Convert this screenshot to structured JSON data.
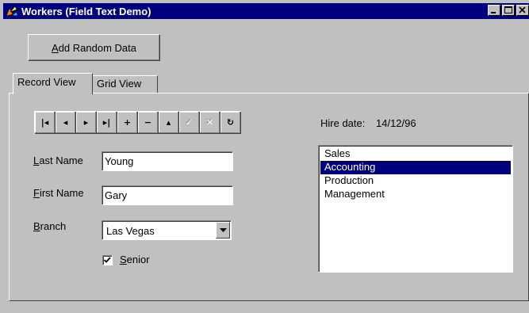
{
  "window": {
    "title": "Workers (Field Text Demo)",
    "title_bg": "#00007f"
  },
  "toolbar": {
    "add_button_label": "Add Random Data"
  },
  "tabs": [
    {
      "label": "Record View",
      "active": true
    },
    {
      "label": "Grid View",
      "active": false
    }
  ],
  "navigator": {
    "buttons": [
      {
        "name": "first-record-button",
        "glyph": "|◂",
        "enabled": true
      },
      {
        "name": "prior-record-button",
        "glyph": "◂",
        "enabled": true
      },
      {
        "name": "next-record-button",
        "glyph": "▸",
        "enabled": true
      },
      {
        "name": "last-record-button",
        "glyph": "▸|",
        "enabled": true
      },
      {
        "name": "insert-record-button",
        "glyph": "+",
        "enabled": true
      },
      {
        "name": "delete-record-button",
        "glyph": "−",
        "enabled": true
      },
      {
        "name": "edit-record-button",
        "glyph": "▴",
        "enabled": true
      },
      {
        "name": "post-record-button",
        "glyph": "✓",
        "enabled": false
      },
      {
        "name": "cancel-record-button",
        "glyph": "✕",
        "enabled": false
      },
      {
        "name": "refresh-record-button",
        "glyph": "↻",
        "enabled": true
      }
    ]
  },
  "hire": {
    "label": "Hire date:",
    "value": "14/12/96"
  },
  "fields": {
    "last_name": {
      "label_first": "L",
      "label_rest": "ast Name",
      "value": "Young"
    },
    "first_name": {
      "label_first": "F",
      "label_rest": "irst Name",
      "value": "Gary"
    },
    "branch": {
      "label_first": "B",
      "label_rest": "ranch",
      "value": "Las Vegas"
    },
    "senior": {
      "label_first": "S",
      "label_rest": "enior",
      "checked": true
    }
  },
  "departments": {
    "items": [
      "Sales",
      "Accounting",
      "Production",
      "Management"
    ],
    "selected": "Accounting"
  }
}
